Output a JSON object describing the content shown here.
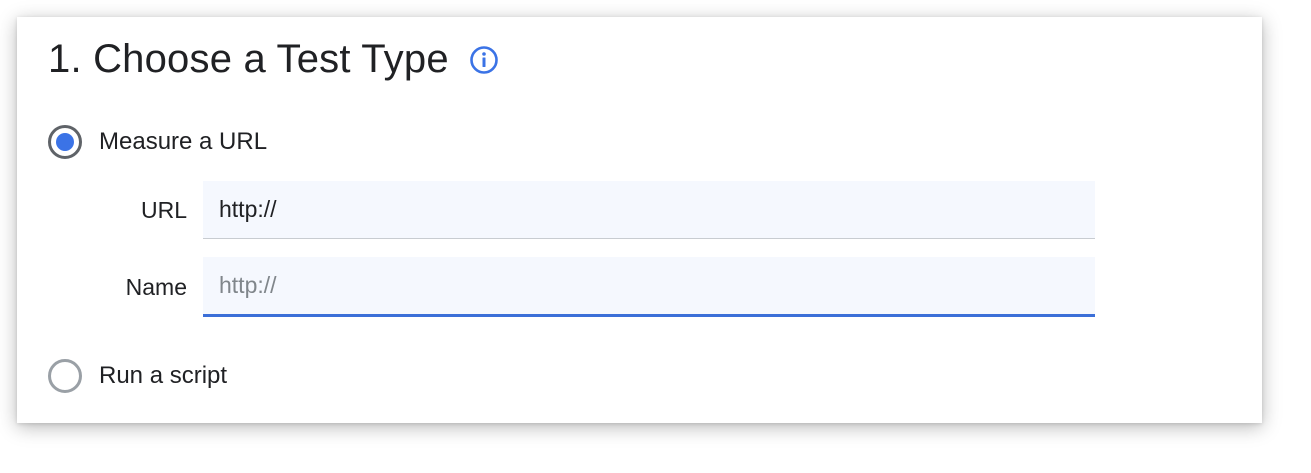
{
  "section": {
    "title": "1. Choose a Test Type",
    "info_icon": "info-circle-icon"
  },
  "options": {
    "measure_url": {
      "label": "Measure a URL",
      "selected": true
    },
    "run_script": {
      "label": "Run a script",
      "selected": false
    }
  },
  "fields": {
    "url": {
      "label": "URL",
      "value": "http://",
      "placeholder": ""
    },
    "name": {
      "label": "Name",
      "value": "",
      "placeholder": "http://"
    }
  },
  "colors": {
    "accent": "#3b73e6",
    "input_background": "#f5f8fe",
    "text": "#202124"
  }
}
